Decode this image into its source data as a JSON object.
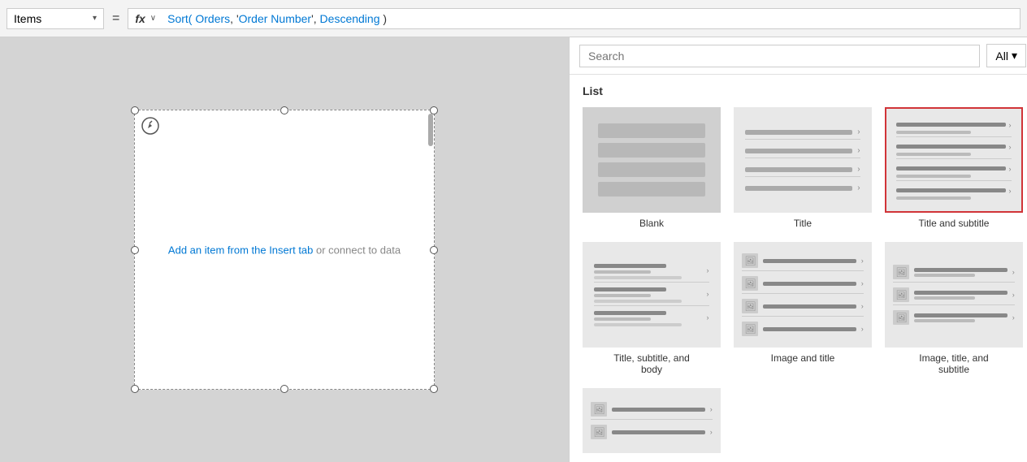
{
  "topbar": {
    "items_label": "Items",
    "chevron": "▾",
    "equals": "=",
    "fx_label": "fx",
    "formula": "Sort( Orders, 'Order Number', Descending )",
    "formula_parts": [
      {
        "text": "Sort(",
        "type": "keyword"
      },
      {
        "text": " Orders,",
        "type": "blue"
      },
      {
        "text": " '",
        "type": "black"
      },
      {
        "text": "Order Number",
        "type": "blue"
      },
      {
        "text": "',",
        "type": "black"
      },
      {
        "text": " Descending",
        "type": "blue"
      },
      {
        "text": " )",
        "type": "black"
      }
    ]
  },
  "canvas": {
    "add_item_text": "Add an item from the Insert tab",
    "add_item_suffix": " or connect to data"
  },
  "panel": {
    "search_placeholder": "Search",
    "all_label": "All",
    "section_label": "List",
    "layouts": [
      {
        "id": "blank",
        "label": "Blank",
        "type": "blank",
        "selected": false
      },
      {
        "id": "title",
        "label": "Title",
        "type": "title",
        "selected": false
      },
      {
        "id": "title-subtitle",
        "label": "Title and subtitle",
        "type": "title-subtitle",
        "selected": true
      },
      {
        "id": "title-subtitle-body",
        "label": "Title, subtitle, and body",
        "type": "title-subtitle-body",
        "selected": false
      },
      {
        "id": "image-title",
        "label": "Image and title",
        "type": "image-title",
        "selected": false
      },
      {
        "id": "image-title-subtitle",
        "label": "Image, title, and subtitle",
        "type": "image-title-subtitle",
        "selected": false
      }
    ],
    "partial_layouts": [
      {
        "id": "image-title-2",
        "label": "",
        "type": "image-title-small",
        "selected": false
      }
    ]
  }
}
